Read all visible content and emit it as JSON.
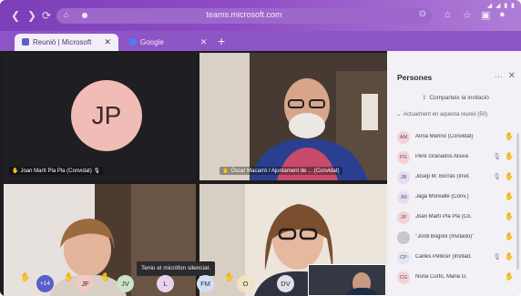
{
  "browser": {
    "url": "teams.microsoft.com",
    "status_bar": "◢ ◢ ▮ ▮",
    "tabs": [
      {
        "label": "Reunió | Microsoft",
        "color": "#5b5fc7",
        "active": true
      },
      {
        "label": "Google",
        "color": "#4285f4",
        "active": false
      }
    ],
    "new_tab": "+"
  },
  "tiles": [
    {
      "initials": "JP",
      "name": "Joan Martí Pla Pla (Convidat)"
    },
    {
      "name": "Òscar Macarró / Ajuntament de ... (Convidat)"
    }
  ],
  "toast": "Teniu el micròfon silenciat.",
  "bottom_row": {
    "count": "+14",
    "avatars": [
      {
        "initials": "JF",
        "color": "#f3c9c3"
      },
      {
        "initials": "JV",
        "color": "#cbe3c9"
      },
      {
        "initials": "L",
        "color": "#e7d3f0"
      },
      {
        "initials": "FM",
        "color": "#cfe0f3"
      },
      {
        "initials": "O",
        "color": "#f0e2c4"
      },
      {
        "initials": "DV",
        "color": "#e0e0e6"
      }
    ]
  },
  "panel": {
    "title": "Persones",
    "more": "···",
    "close": "✕",
    "share": "Comparteix la invitació",
    "section": "Actualment en aquesta reunió (50)",
    "people": [
      {
        "initials": "AM",
        "name": "Anna Merino (Convidat)",
        "color": "#f5d2d7"
      },
      {
        "initials": "PG",
        "name": "Pere Granados Alsiva",
        "color": "#f5d2d7"
      },
      {
        "initials": "JB",
        "name": "Josep M. Borrás (Invit.",
        "color": "#e8dcf1"
      },
      {
        "initials": "JM",
        "name": "Jaga Moreallé (Conv.)",
        "color": "#e8dcf1"
      },
      {
        "initials": "JP",
        "name": "Joan Martí Pla Pla (Co.",
        "color": "#f5d2d7"
      },
      {
        "initials": "",
        "name": "\"Jordi Bogoni (Invitado)\"",
        "color": "#c9c6cd"
      },
      {
        "initials": "CP",
        "name": "Carles Pellicer (Invitad.",
        "color": "#dfe6f1"
      },
      {
        "initials": "CG",
        "name": "Núria Curto, Marià G.",
        "color": "#f5d2d7"
      }
    ]
  }
}
